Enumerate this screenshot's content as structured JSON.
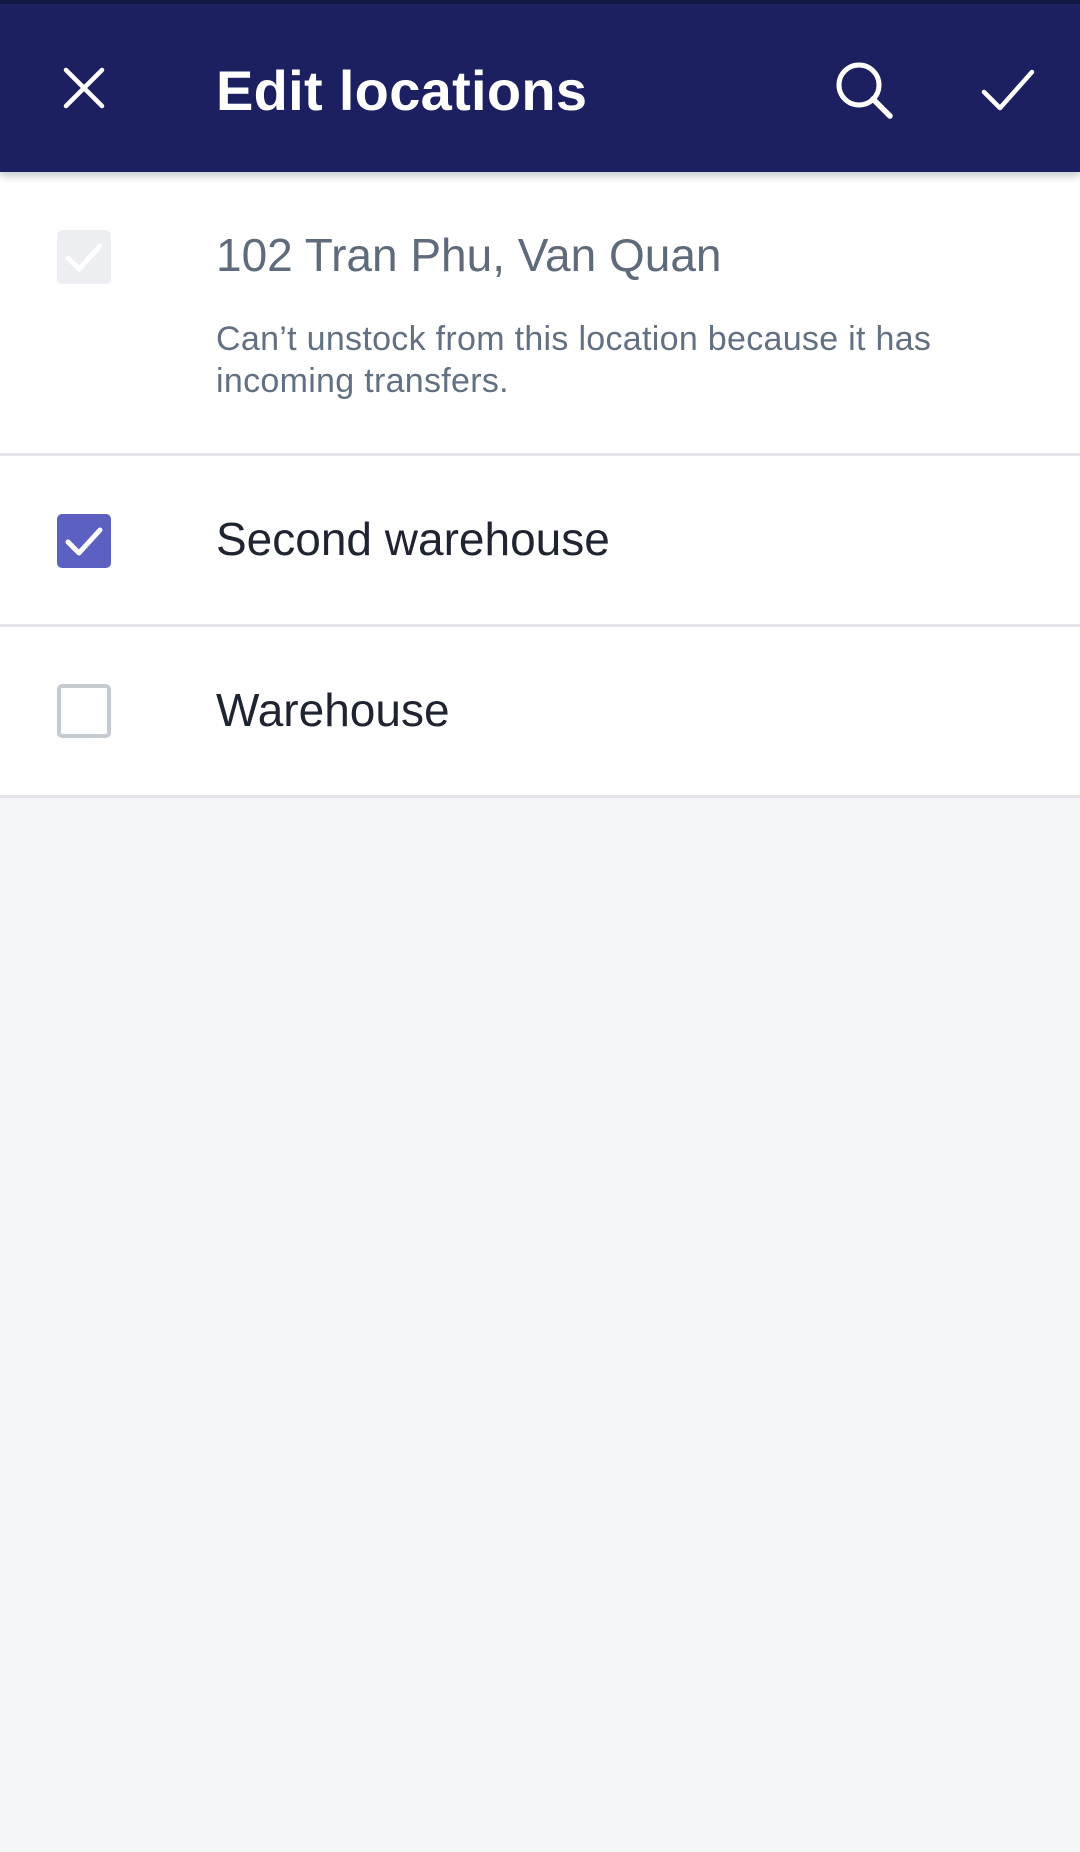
{
  "appbar": {
    "title": "Edit locations",
    "close_icon": "close-icon",
    "search_icon": "search-icon",
    "save_icon": "check-icon",
    "background_color": "#1c2060"
  },
  "locations": [
    {
      "name": "102 Tran Phu, Van Quan",
      "checked": true,
      "disabled": true,
      "note": "Can’t unstock from this location because it has incoming transfers."
    },
    {
      "name": "Second warehouse",
      "checked": true,
      "disabled": false
    },
    {
      "name": "Warehouse",
      "checked": false,
      "disabled": false
    }
  ],
  "colors": {
    "accent_checkbox": "#5c60c0",
    "page_background": "#f4f5f8"
  }
}
